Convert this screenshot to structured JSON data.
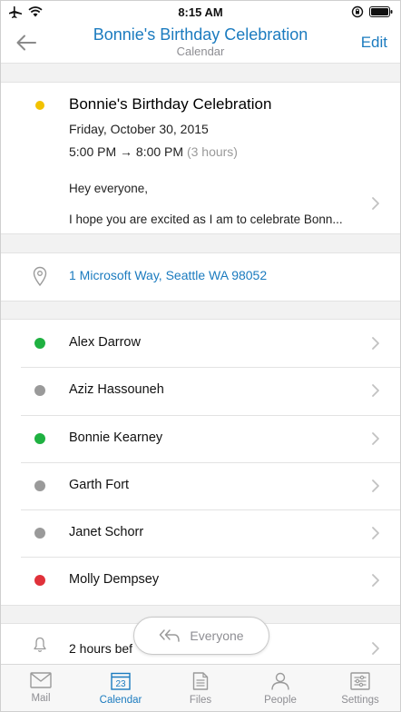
{
  "status": {
    "time": "8:15 AM"
  },
  "nav": {
    "title": "Bonnie's Birthday Celebration",
    "subtitle": "Calendar",
    "edit": "Edit"
  },
  "event": {
    "title": "Bonnie's Birthday Celebration",
    "date": "Friday, October 30, 2015",
    "time_range": "5:00 PM → 8:00 PM",
    "duration": "(3 hours)",
    "greeting": "Hey everyone,",
    "body_preview": "I hope you are excited as I am to celebrate Bonn..."
  },
  "location": "1 Microsoft Way, Seattle WA 98052",
  "attendees": [
    {
      "name": "Alex Darrow",
      "status_color": "#1fb141"
    },
    {
      "name": "Aziz Hassouneh",
      "status_color": "#9a9a9a"
    },
    {
      "name": "Bonnie Kearney",
      "status_color": "#1fb141"
    },
    {
      "name": "Garth Fort",
      "status_color": "#9a9a9a"
    },
    {
      "name": "Janet Schorr",
      "status_color": "#9a9a9a"
    },
    {
      "name": "Molly Dempsey",
      "status_color": "#e0313a"
    }
  ],
  "reminder": "2 hours bef",
  "reply_button": "Everyone",
  "tabs": [
    {
      "label": "Mail",
      "icon": "mail-icon"
    },
    {
      "label": "Calendar",
      "icon": "calendar-icon",
      "date": "23",
      "active": true
    },
    {
      "label": "Files",
      "icon": "files-icon"
    },
    {
      "label": "People",
      "icon": "people-icon"
    },
    {
      "label": "Settings",
      "icon": "settings-icon"
    }
  ],
  "colors": {
    "accent": "#1b7bbf",
    "event_dot": "#f2c200",
    "muted": "#8e8e93"
  }
}
